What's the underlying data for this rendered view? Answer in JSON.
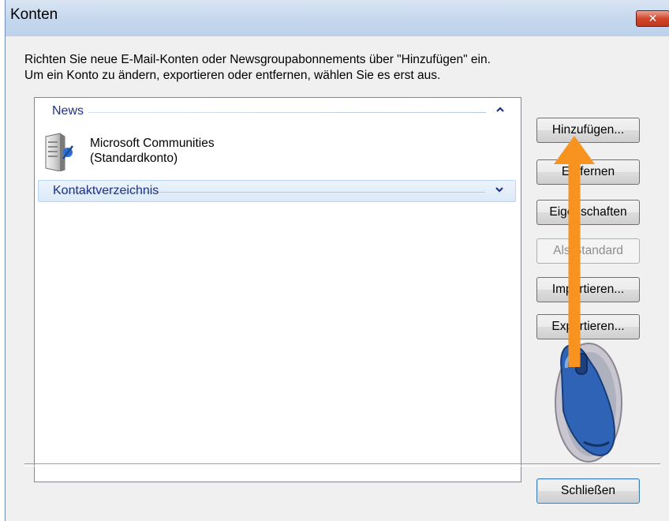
{
  "window": {
    "title": "Konten",
    "close_symbol": "✕"
  },
  "intro": {
    "line1": "Richten Sie neue E-Mail-Konten oder Newsgroupabonnements über \"Hinzufügen\" ein.",
    "line2": "Um ein Konto zu ändern, exportieren oder entfernen, wählen Sie es erst aus."
  },
  "list": {
    "groups": [
      {
        "label": "News",
        "chevron": "^",
        "expanded": true,
        "items": [
          {
            "name": "Microsoft Communities",
            "subtitle": "(Standardkonto)",
            "icon": "news-server-icon"
          }
        ]
      },
      {
        "label": "Kontaktverzeichnis",
        "chevron": "v",
        "expanded": false,
        "items": []
      }
    ]
  },
  "buttons": {
    "add": "Hinzufügen...",
    "remove": "Entfernen",
    "properties": "Eigenschaften",
    "set_default": "Als Standard",
    "import": "Importieren...",
    "export": "Exportieren...",
    "close": "Schließen"
  },
  "overlay": {
    "arrow_color": "#f7931e",
    "mouse_icon": "mouse-icon",
    "mouse_color": "#2f63b5"
  },
  "colors": {
    "group_header_text": "#1e3287",
    "selected_group_bg": "#dbe9f8",
    "titlebar": "#c6d8ee"
  }
}
